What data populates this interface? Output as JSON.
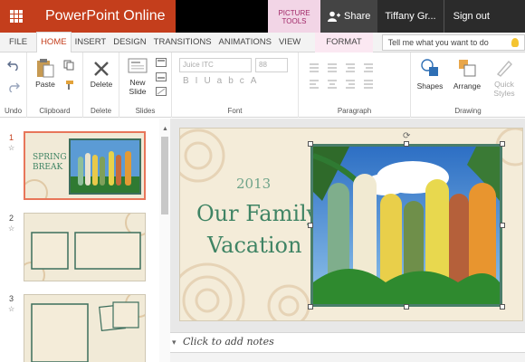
{
  "titlebar": {
    "app_name": "PowerPoint Online",
    "context_tab_group": "PICTURE TOOLS",
    "share_label": "Share",
    "user_name": "Tiffany Gr...",
    "sign_out": "Sign out",
    "accent": "#c43e1c"
  },
  "tabs": {
    "items": [
      "FILE",
      "HOME",
      "INSERT",
      "DESIGN",
      "TRANSITIONS",
      "ANIMATIONS",
      "VIEW"
    ],
    "active": "HOME",
    "format": "FORMAT",
    "tell_me_placeholder": "Tell me what you want to do"
  },
  "ribbon": {
    "undo": {
      "label": "Undo"
    },
    "clipboard": {
      "label": "Clipboard",
      "paste": "Paste"
    },
    "delete": {
      "label": "Delete",
      "button": "Delete"
    },
    "slides": {
      "label": "Slides",
      "new_slide": "New\nSlide"
    },
    "font": {
      "label": "Font",
      "font_name": "Juice ITC",
      "font_size": "88"
    },
    "paragraph": {
      "label": "Paragraph"
    },
    "drawing": {
      "label": "Drawing",
      "shapes": "Shapes",
      "arrange": "Arrange",
      "quick_styles": "Quick\nStyles"
    }
  },
  "thumbnails": [
    {
      "number": "1",
      "selected": true,
      "line1": "SPRING",
      "line2": "BREAK"
    },
    {
      "number": "2",
      "selected": false
    },
    {
      "number": "3",
      "selected": false
    }
  ],
  "slide": {
    "year": "2013",
    "title_line1": "Our Family",
    "title_line2": "Vacation"
  },
  "notes_placeholder": "Click to add notes"
}
